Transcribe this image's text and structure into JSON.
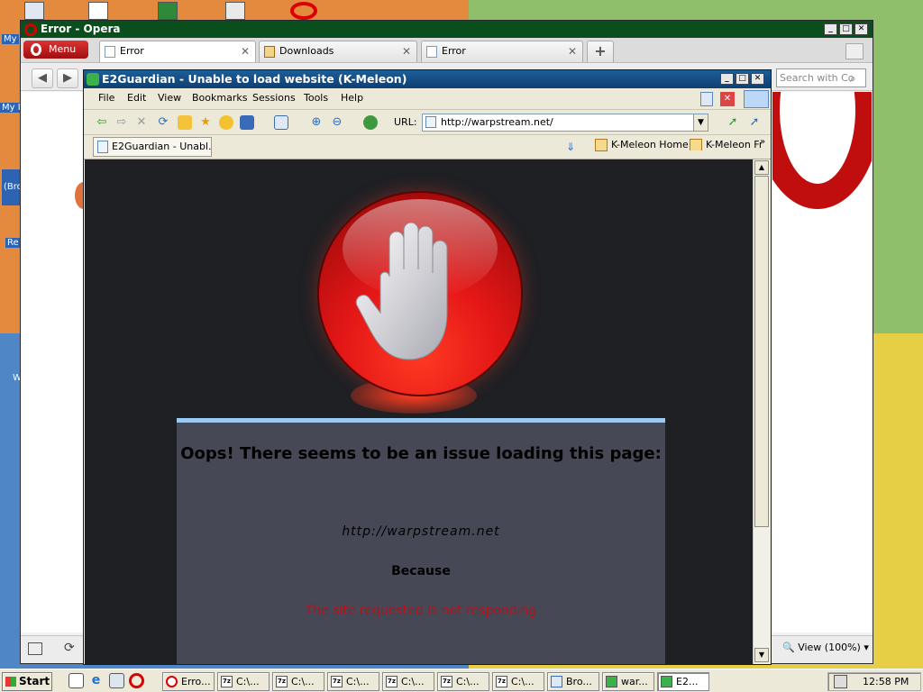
{
  "desktop": {
    "icons": [
      {
        "label": "My"
      },
      {
        "label": "My I"
      },
      {
        "label": "(Bro"
      },
      {
        "label": "Re"
      },
      {
        "label": "W"
      }
    ]
  },
  "opera": {
    "window_title": "Error - Opera",
    "menu_label": "Menu",
    "tabs": [
      {
        "label": "Error"
      },
      {
        "label": "Downloads"
      },
      {
        "label": "Error"
      }
    ],
    "add_tab": "+",
    "search_placeholder": "Search with Co",
    "zoom_label": "View (100%)"
  },
  "kmeleon": {
    "window_title": "E2Guardian - Unable to load website (K-Meleon)",
    "menus": [
      "File",
      "Edit",
      "View",
      "Bookmarks",
      "Sessions",
      "Tools",
      "Help"
    ],
    "url_label": "URL:",
    "url_value": "http://warpstream.net/",
    "tab_label": "E2Guardian - Unabl...",
    "bookmarks": [
      {
        "label": "K-Meleon Home"
      },
      {
        "label": "K-Meleon Fr"
      }
    ]
  },
  "page": {
    "heading": "Oops! There seems to be an issue loading this page:",
    "url": "http://warpstream.net",
    "because": "Because",
    "reason": "The site requested is not responding"
  },
  "taskbar": {
    "start_label": "Start",
    "tasks": [
      {
        "label": "Erro..."
      },
      {
        "label": "C:\\..."
      },
      {
        "label": "C:\\..."
      },
      {
        "label": "C:\\..."
      },
      {
        "label": "C:\\..."
      },
      {
        "label": "C:\\..."
      },
      {
        "label": "C:\\..."
      },
      {
        "label": "Bro..."
      },
      {
        "label": "war..."
      },
      {
        "label": "E2..."
      }
    ],
    "time": "12:58 PM"
  }
}
